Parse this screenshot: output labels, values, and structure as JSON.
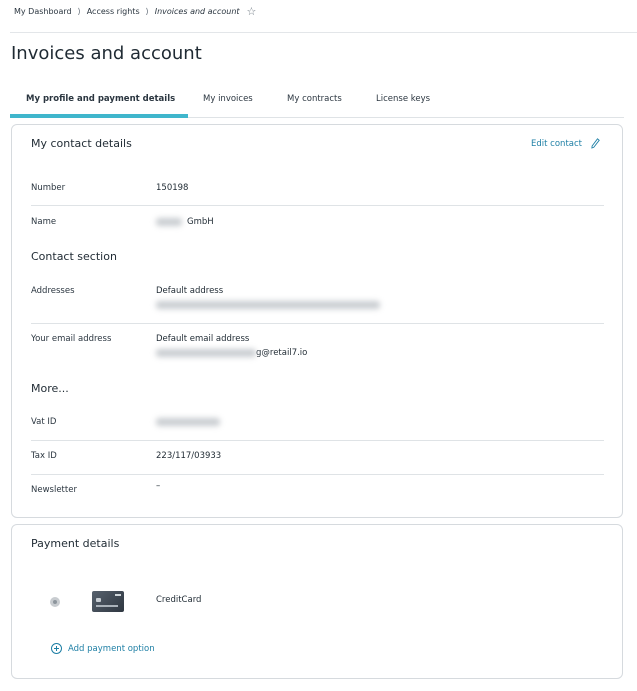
{
  "breadcrumb": {
    "items": [
      "My Dashboard",
      "Access rights",
      "Invoices and account"
    ],
    "separator": "⟩",
    "star": "☆"
  },
  "page_title": "Invoices and account",
  "tabs": [
    {
      "label": "My profile and payment details",
      "active": true
    },
    {
      "label": "My invoices",
      "active": false
    },
    {
      "label": "My contracts",
      "active": false
    },
    {
      "label": "License keys",
      "active": false
    }
  ],
  "contact": {
    "title": "My contact details",
    "edit_label": "Edit contact",
    "number_label": "Number",
    "number_value": "150198",
    "name_label": "Name",
    "name_value": "GmbH",
    "contact_section_title": "Contact section",
    "addresses_label": "Addresses",
    "addresses_value": "Default address",
    "email_label": "Your email address",
    "email_value": "Default email address",
    "email_suffix": "g@retail7.io",
    "more_title": "More...",
    "vat_label": "Vat ID",
    "tax_label": "Tax ID",
    "tax_value": "223/117/03933",
    "newsletter_label": "Newsletter",
    "newsletter_value": "–"
  },
  "payment": {
    "title": "Payment details",
    "method_label": "CreditCard",
    "add_label": "Add payment option"
  },
  "colors": {
    "accent": "#3fb6cc",
    "link": "#1e7fa5",
    "border": "#d6dade"
  },
  "icons": {
    "star": "star-icon",
    "edit": "pencil-icon",
    "add": "plus-circle-icon",
    "card": "credit-card-icon"
  }
}
